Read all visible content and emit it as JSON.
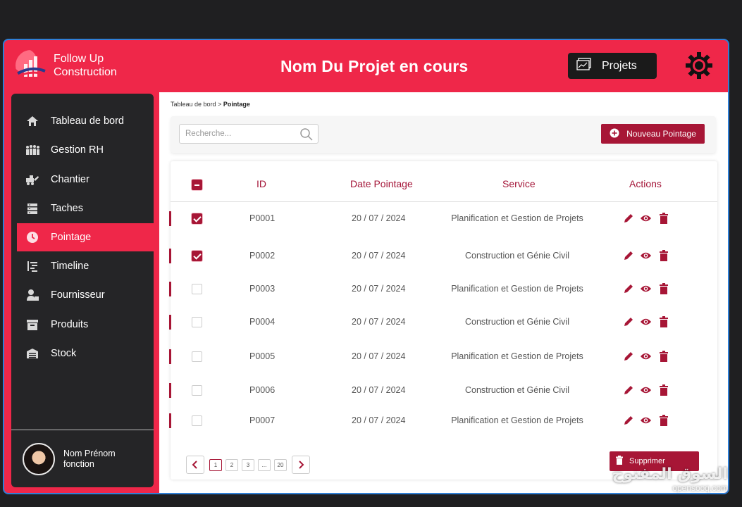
{
  "app": {
    "logo_text_line1": "Follow Up",
    "logo_text_line2": "Construction",
    "page_title": "Nom Du Projet en cours",
    "projects_button": "Projets",
    "accent_color": "#ef2749",
    "dark_accent_color": "#a71636"
  },
  "sidebar": {
    "items": [
      {
        "label": "Tableau de bord",
        "icon": "home-icon"
      },
      {
        "label": "Gestion RH",
        "icon": "people-icon"
      },
      {
        "label": "Chantier",
        "icon": "construction-vehicle-icon"
      },
      {
        "label": "Taches",
        "icon": "tasks-icon"
      },
      {
        "label": "Pointage",
        "icon": "clock-icon",
        "active": true
      },
      {
        "label": "Timeline",
        "icon": "timeline-icon"
      },
      {
        "label": "Fournisseur",
        "icon": "supplier-icon"
      },
      {
        "label": "Produits",
        "icon": "box-icon"
      },
      {
        "label": "Stock",
        "icon": "warehouse-icon"
      }
    ],
    "user": {
      "name": "Nom Prénom",
      "role": "fonction"
    }
  },
  "breadcrumb": {
    "parent": "Tableau de bord",
    "separator": " > ",
    "current": "Pointage"
  },
  "toolbar": {
    "search_placeholder": "Recherche...",
    "new_button": "Nouveau Pointage"
  },
  "table": {
    "headers": {
      "id": "ID",
      "date": "Date Pointage",
      "service": "Service",
      "actions": "Actions"
    },
    "rows": [
      {
        "id": "P0001",
        "date": "20 / 07 / 2024",
        "service": "Planification et Gestion de Projets",
        "checked": true
      },
      {
        "id": "P0002",
        "date": "20 / 07 / 2024",
        "service": "Construction et Génie Civil",
        "checked": true
      },
      {
        "id": "P0003",
        "date": "20 / 07 / 2024",
        "service": "Planification et Gestion de Projets",
        "checked": false
      },
      {
        "id": "P0004",
        "date": "20 / 07 / 2024",
        "service": "Construction et Génie Civil",
        "checked": false
      },
      {
        "id": "P0005",
        "date": "20 / 07 / 2024",
        "service": "Planification et Gestion de Projets",
        "checked": false
      },
      {
        "id": "P0006",
        "date": "20 / 07 / 2024",
        "service": "Construction et Génie Civil",
        "checked": false
      },
      {
        "id": "P0007",
        "date": "20 / 07 / 2024",
        "service": "Planification et Gestion de Projets",
        "checked": false
      }
    ]
  },
  "pagination": {
    "pages": [
      "1",
      "2",
      "3",
      "...",
      "20"
    ],
    "current": "1"
  },
  "delete_button": "Supprimer",
  "watermark": {
    "line1": "السوق المفتوح",
    "line2": "opensooq.com"
  }
}
